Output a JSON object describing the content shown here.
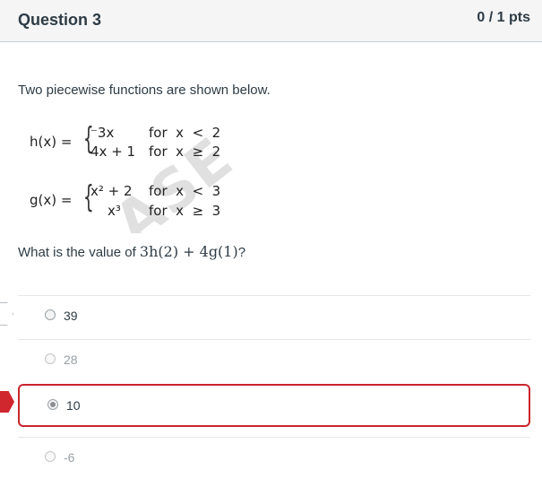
{
  "header": {
    "title": "Question 3",
    "points": "0 / 1 pts"
  },
  "watermark": "ASE",
  "intro": "Two piecewise functions are shown below.",
  "h": {
    "lhs": "h(x) =",
    "cases": [
      {
        "expr": "⁻3x",
        "cond": "for  x  <  2"
      },
      {
        "expr": "4x + 1",
        "cond": "for  x  ≥  2"
      }
    ]
  },
  "g": {
    "lhs": "g(x) =",
    "cases": [
      {
        "expr": "x² + 2",
        "cond": "for  x  <  3"
      },
      {
        "expr": "x³",
        "cond": "for  x  ≥  3"
      }
    ]
  },
  "question": {
    "prefix": "What is the value of ",
    "expr": "3h(2) + 4g(1)",
    "suffix": "?"
  },
  "answers": [
    {
      "label": "39",
      "selected": false
    },
    {
      "label": "28",
      "selected": false
    },
    {
      "label": "10",
      "selected": true
    },
    {
      "label": "-6",
      "selected": false
    }
  ],
  "colors": {
    "selected_border": "#c9252c",
    "marker_red": "#d0262e",
    "header_bg": "#f5f5f5"
  }
}
